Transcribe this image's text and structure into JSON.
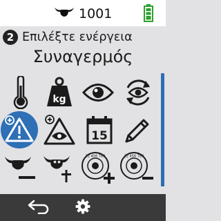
{
  "status": {
    "cow_number": "1001",
    "cow_icon": "cow-head-icon",
    "battery_icon": "battery-full-icon",
    "battery_color": "#2ca02c"
  },
  "header": {
    "step_number": "2",
    "step_label": "Επιλέξτε ενέργεια"
  },
  "menu": {
    "title": "Συναγερμός",
    "accent_color": "#2e6fb5",
    "selected_item": "alarm-add",
    "items": [
      {
        "icon": "thermometer-icon",
        "action": "temperature"
      },
      {
        "icon": "weight-kg-icon",
        "action": "weight",
        "text": "kg"
      },
      {
        "icon": "eye-icon",
        "action": "observation"
      },
      {
        "icon": "eye-repeat-icon",
        "action": "repeat-observation"
      },
      {
        "icon": "alarm-add-icon",
        "action": "alarm-add"
      },
      {
        "icon": "observation-add-icon",
        "action": "observation-add"
      },
      {
        "icon": "calendar-icon",
        "action": "calendar",
        "text": "15"
      },
      {
        "icon": "pencil-icon",
        "action": "edit"
      },
      {
        "icon": "cow-remove-icon",
        "action": "remove-cow"
      },
      {
        "icon": "cow-dead-icon",
        "action": "dead-cow"
      },
      {
        "icon": "tag-add-icon",
        "action": "tag-add",
        "text": "12 456 789"
      },
      {
        "icon": "tag-remove-icon",
        "action": "tag-remove",
        "text": "12 456 789"
      }
    ]
  },
  "footer": {
    "back_icon": "back-arrow-icon",
    "settings_icon": "gear-icon"
  }
}
